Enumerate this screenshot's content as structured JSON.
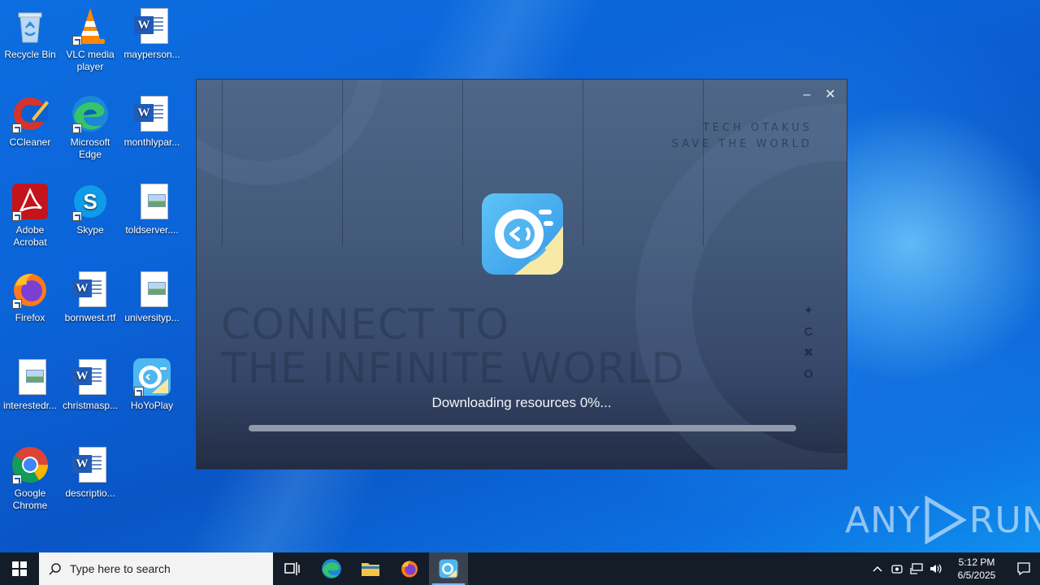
{
  "desktop": {
    "icons": [
      {
        "label": "Recycle Bin"
      },
      {
        "label": "VLC media player"
      },
      {
        "label": "mayperson..."
      },
      {
        "label": "CCleaner"
      },
      {
        "label": "Microsoft Edge"
      },
      {
        "label": "monthlypar..."
      },
      {
        "label": "Adobe Acrobat"
      },
      {
        "label": "Skype"
      },
      {
        "label": "toldserver...."
      },
      {
        "label": "Firefox"
      },
      {
        "label": "bornwest.rtf"
      },
      {
        "label": "universityp..."
      },
      {
        "label": "interestedr..."
      },
      {
        "label": "christmasp..."
      },
      {
        "label": "HoYoPlay"
      },
      {
        "label": "Google Chrome"
      },
      {
        "label": "descriptio..."
      }
    ]
  },
  "launcher": {
    "minimize_icon": "minimize-icon",
    "close_icon": "close-icon",
    "minimize_glyph": "–",
    "close_glyph": "✕",
    "tagline_line1": "TECH OTAKUS",
    "tagline_line2": "SAVE THE WORLD",
    "background_line1": "CONNECT TO",
    "background_line2": "THE INFINITE WORLD",
    "side_symbols": [
      "✦",
      "C",
      "✖",
      "O"
    ],
    "status": "Downloading resources 0%...",
    "progress": 0
  },
  "watermark": {
    "text_left": "ANY",
    "text_right": "RUN"
  },
  "taskbar": {
    "search_placeholder": "Type here to search",
    "time": "5:12 PM",
    "date": "6/5/2025"
  },
  "colors": {
    "accent": "#0a5fd0",
    "taskbar": "#141c28",
    "launcher_bg": "#435a7a"
  }
}
